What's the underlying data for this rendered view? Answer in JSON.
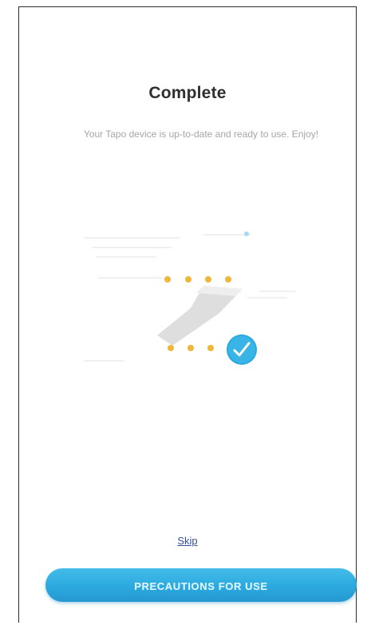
{
  "screen": {
    "title": "Complete",
    "subtitle": "Your Tapo device is up-to-date and ready to use. Enjoy!"
  },
  "actions": {
    "skip_label": "Skip",
    "primary_button_label": "PRECAUTIONS FOR USE"
  },
  "illustration": {
    "name": "firmware-update-complete",
    "check_icon": "check-circle-icon"
  },
  "colors": {
    "background": "#ffffff",
    "title": "#2f2f2f",
    "subtitle": "#a6a6a6",
    "accent_blue": "#2aa9df",
    "dot_yellow": "#f0b63a",
    "link_blue": "#334f9a"
  }
}
